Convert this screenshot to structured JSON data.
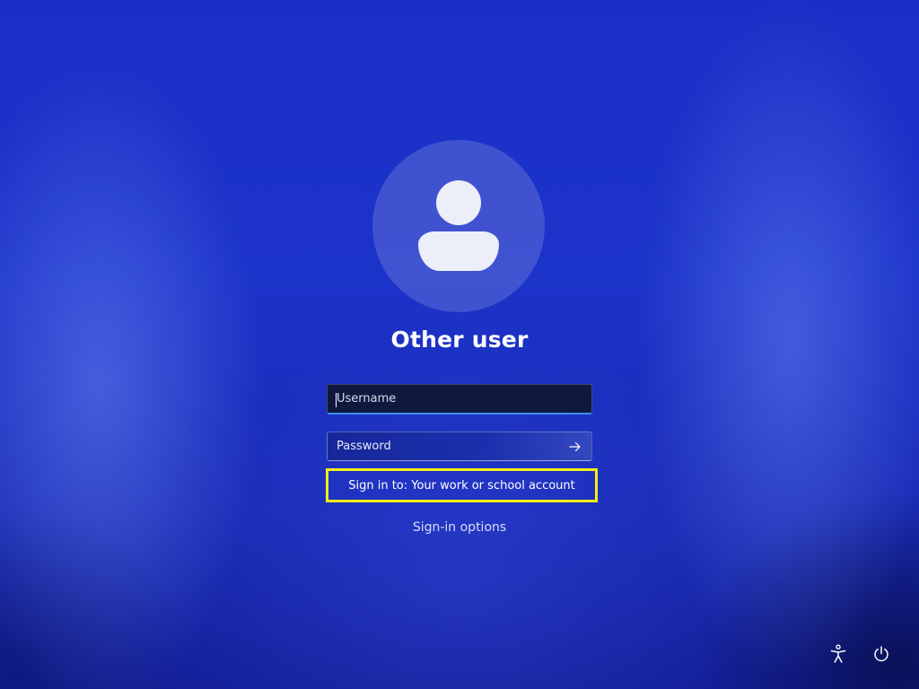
{
  "user": {
    "display_name": "Other user",
    "avatar_icon": "person-icon"
  },
  "form": {
    "username_placeholder": "Username",
    "password_placeholder": "Password",
    "submit_icon": "arrow-right-icon",
    "sign_in_to": "Sign in to: Your work or school account",
    "sign_in_options": "Sign-in options"
  },
  "system_buttons": {
    "accessibility_icon": "accessibility-icon",
    "power_icon": "power-icon"
  },
  "colors": {
    "background": "#1c33c9",
    "highlight_box": "#f5ee17",
    "focus_underline": "#3d8ff0"
  }
}
